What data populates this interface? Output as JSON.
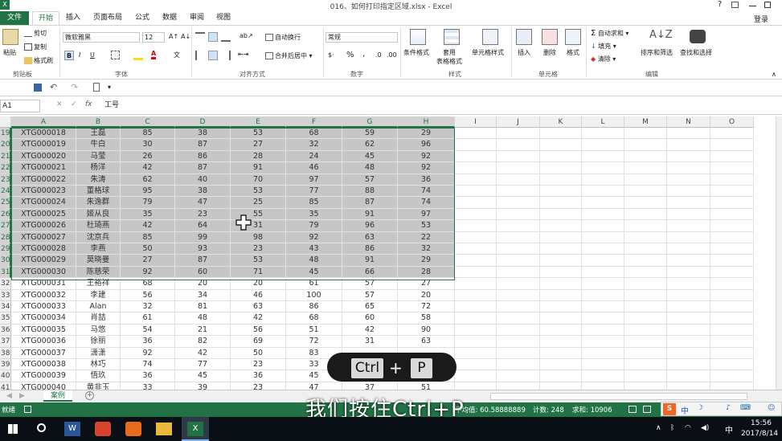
{
  "window": {
    "title": "016、如何打印指定区域.xlsx - Excel",
    "login": "登录",
    "help": "?"
  },
  "tabs": [
    "文件",
    "开始",
    "插入",
    "页面布局",
    "公式",
    "数据",
    "审阅",
    "视图"
  ],
  "active_tab": "开始",
  "ribbon": {
    "clipboard": {
      "label": "剪贴板",
      "paste": "粘贴",
      "cut": "剪切",
      "copy": "复制",
      "format_painter": "格式刷"
    },
    "font": {
      "label": "字体",
      "family": "微软雅黑",
      "size": "12",
      "bold": "B",
      "italic": "I",
      "underline": "U"
    },
    "alignment": {
      "label": "对齐方式",
      "wrap": "自动换行",
      "merge": "合并后居中"
    },
    "number": {
      "label": "数字",
      "format": "常规",
      "percent": "%",
      "comma": ","
    },
    "styles": {
      "label": "样式",
      "conditional": "条件格式",
      "table": "套用\n表格格式",
      "cell_styles": "单元格样式"
    },
    "cells": {
      "label": "单元格",
      "insert": "插入",
      "delete": "删除",
      "format": "格式"
    },
    "editing": {
      "label": "编辑",
      "autosum": "自动求和",
      "fill": "填充",
      "clear": "清除",
      "sort": "排序和筛选",
      "find": "查找和选择"
    }
  },
  "formula_bar": {
    "name_box": "A1",
    "fx": "fx",
    "content": "工号"
  },
  "columns": [
    "A",
    "B",
    "C",
    "D",
    "E",
    "F",
    "G",
    "H",
    "I",
    "J",
    "K",
    "L",
    "M",
    "N",
    "O"
  ],
  "selected_columns": [
    "A",
    "B",
    "C",
    "D",
    "E",
    "F",
    "G",
    "H"
  ],
  "rows": [
    {
      "n": "19",
      "id": "XTG000018",
      "name": "王磊",
      "c": "85",
      "d": "38",
      "e": "53",
      "f": "68",
      "g": "59",
      "h": "29",
      "sel": true
    },
    {
      "n": "20",
      "id": "XTG000019",
      "name": "牛白",
      "c": "30",
      "d": "87",
      "e": "27",
      "f": "32",
      "g": "62",
      "h": "96",
      "sel": true
    },
    {
      "n": "21",
      "id": "XTG000020",
      "name": "马莹",
      "c": "26",
      "d": "86",
      "e": "28",
      "f": "24",
      "g": "45",
      "h": "92",
      "sel": true
    },
    {
      "n": "22",
      "id": "XTG000021",
      "name": "杨洋",
      "c": "42",
      "d": "87",
      "e": "91",
      "f": "46",
      "g": "48",
      "h": "92",
      "sel": true
    },
    {
      "n": "23",
      "id": "XTG000022",
      "name": "朱涛",
      "c": "62",
      "d": "40",
      "e": "70",
      "f": "97",
      "g": "57",
      "h": "36",
      "sel": true
    },
    {
      "n": "24",
      "id": "XTG000023",
      "name": "董格球",
      "c": "95",
      "d": "38",
      "e": "53",
      "f": "77",
      "g": "88",
      "h": "74",
      "sel": true
    },
    {
      "n": "25",
      "id": "XTG000024",
      "name": "朱逸群",
      "c": "79",
      "d": "47",
      "e": "25",
      "f": "85",
      "g": "87",
      "h": "74",
      "sel": true
    },
    {
      "n": "26",
      "id": "XTG000025",
      "name": "姬从良",
      "c": "35",
      "d": "23",
      "e": "55",
      "f": "35",
      "g": "91",
      "h": "97",
      "sel": true
    },
    {
      "n": "27",
      "id": "XTG000026",
      "name": "杜琦燕",
      "c": "42",
      "d": "64",
      "e": "31",
      "f": "79",
      "g": "96",
      "h": "53",
      "sel": true
    },
    {
      "n": "28",
      "id": "XTG000027",
      "name": "沈京兵",
      "c": "85",
      "d": "99",
      "e": "98",
      "f": "92",
      "g": "63",
      "h": "22",
      "sel": true
    },
    {
      "n": "29",
      "id": "XTG000028",
      "name": "李燕",
      "c": "50",
      "d": "93",
      "e": "23",
      "f": "43",
      "g": "86",
      "h": "32",
      "sel": true
    },
    {
      "n": "30",
      "id": "XTG000029",
      "name": "莫晓曼",
      "c": "27",
      "d": "87",
      "e": "53",
      "f": "48",
      "g": "91",
      "h": "29",
      "sel": true
    },
    {
      "n": "31",
      "id": "XTG000030",
      "name": "陈慈荣",
      "c": "92",
      "d": "60",
      "e": "71",
      "f": "45",
      "g": "66",
      "h": "28",
      "sel": true
    },
    {
      "n": "32",
      "id": "XTG000031",
      "name": "王裕祥",
      "c": "68",
      "d": "20",
      "e": "20",
      "f": "61",
      "g": "57",
      "h": "27",
      "sel": false
    },
    {
      "n": "33",
      "id": "XTG000032",
      "name": "李建",
      "c": "56",
      "d": "34",
      "e": "46",
      "f": "100",
      "g": "57",
      "h": "20",
      "sel": false
    },
    {
      "n": "34",
      "id": "XTG000033",
      "name": "Alan",
      "c": "32",
      "d": "81",
      "e": "63",
      "f": "86",
      "g": "65",
      "h": "72",
      "sel": false
    },
    {
      "n": "35",
      "id": "XTG000034",
      "name": "肖喆",
      "c": "61",
      "d": "48",
      "e": "42",
      "f": "68",
      "g": "60",
      "h": "58",
      "sel": false
    },
    {
      "n": "36",
      "id": "XTG000035",
      "name": "马悠",
      "c": "54",
      "d": "21",
      "e": "56",
      "f": "51",
      "g": "42",
      "h": "90",
      "sel": false
    },
    {
      "n": "37",
      "id": "XTG000036",
      "name": "徐丽",
      "c": "36",
      "d": "82",
      "e": "69",
      "f": "72",
      "g": "31",
      "h": "63",
      "sel": false
    },
    {
      "n": "38",
      "id": "XTG000037",
      "name": "潇潇",
      "c": "92",
      "d": "42",
      "e": "50",
      "f": "83",
      "g": "",
      "h": "",
      "sel": false
    },
    {
      "n": "39",
      "id": "XTG000038",
      "name": "林巧",
      "c": "74",
      "d": "77",
      "e": "23",
      "f": "33",
      "g": "",
      "h": "",
      "sel": false
    },
    {
      "n": "40",
      "id": "XTG000039",
      "name": "悟玖",
      "c": "36",
      "d": "45",
      "e": "36",
      "f": "45",
      "g": "",
      "h": "",
      "sel": false
    },
    {
      "n": "41",
      "id": "XTG000040",
      "name": "黄非玉",
      "c": "33",
      "d": "39",
      "e": "23",
      "f": "47",
      "g": "37",
      "h": "51",
      "sel": false
    }
  ],
  "sheet_tabs": [
    "案例"
  ],
  "status": {
    "ready": "就绪",
    "average": "平均值: 60.58888889",
    "count": "计数: 248",
    "sum": "求和: 10906"
  },
  "overlay": {
    "key1": "Ctrl",
    "plus": "+",
    "key2": "P",
    "subtitle": "我们按住Ctrl+P"
  },
  "taskbar": {
    "time": "15:56",
    "date": "2017/8/14",
    "ime": "中"
  }
}
